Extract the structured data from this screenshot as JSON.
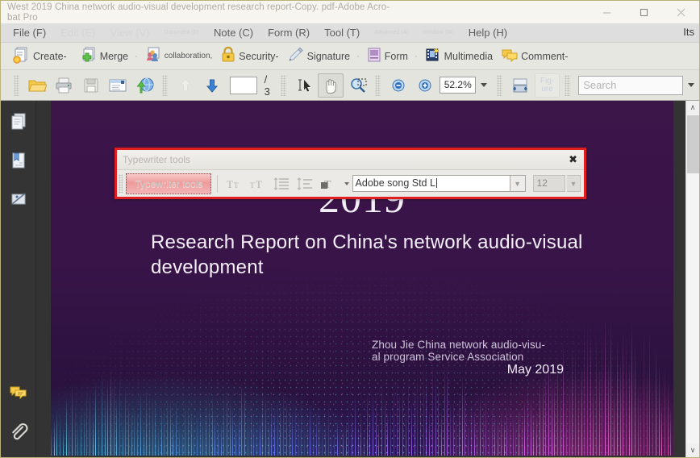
{
  "window": {
    "title": "West 2019 China network audio-visual development research report-Copy. pdf-Adobe Acro-\nbat Pro",
    "minimize_label": "Minimize",
    "maximize_label": "Maximize",
    "close_label": "Close"
  },
  "menubar": {
    "items": [
      {
        "label": "File (F)",
        "state": "normal"
      },
      {
        "label": "Edit (E)",
        "state": "faded"
      },
      {
        "label": "View (V)",
        "state": "faded"
      },
      {
        "label": "Document (D)",
        "state": "faded-small"
      },
      {
        "label": "Note (C)",
        "state": "normal"
      },
      {
        "label": "Form (R)",
        "state": "normal"
      },
      {
        "label": "Tool (T)",
        "state": "normal"
      },
      {
        "label": "Advanced (A)",
        "state": "faded-small"
      },
      {
        "label": "Window (W)",
        "state": "faded-small"
      },
      {
        "label": "Help (H)",
        "state": "normal"
      }
    ],
    "corner_text": "Its"
  },
  "toolbar_main": {
    "buttons": [
      {
        "label": "Create-",
        "icon": "create-document-icon",
        "sep": ""
      },
      {
        "label": "Merge",
        "icon": "merge-documents-icon",
        "sep": "·"
      },
      {
        "label": "collaboration,",
        "icon": "collaboration-icon",
        "sep": ""
      },
      {
        "label": "Security-",
        "icon": "lock-security-icon",
        "sep": ""
      },
      {
        "label": "Signature",
        "icon": "pen-signature-icon",
        "sep": "·"
      },
      {
        "label": "Form",
        "icon": "form-icon",
        "sep": "·"
      },
      {
        "label": "Multimedia",
        "icon": "multimedia-film-icon",
        "sep": ""
      },
      {
        "label": "Comment-",
        "icon": "comment-bubble-icon",
        "sep": ""
      }
    ]
  },
  "toolbar_nav": {
    "open_icon": "open-folder-icon",
    "print_icon": "print-icon",
    "save_icon": "save-floppy-icon",
    "email_icon": "email-icon",
    "upload_icon": "upload-web-icon",
    "prev_page_icon": "previous-page-icon",
    "next_page_icon": "next-page-icon",
    "page_number": "",
    "page_total": "/ 3",
    "select_tool_icon": "select-text-icon",
    "hand_tool_icon": "hand-tool-icon",
    "zoom_tool_icon": "marquee-zoom-icon",
    "zoom_out_icon": "zoom-out-icon",
    "zoom_in_icon": "zoom-in-icon",
    "zoom_value": "52.2%",
    "fit_width_icon": "fit-width-icon",
    "figure_label_line1": "Fig-",
    "figure_label_line2": "ure",
    "search_placeholder": "Search"
  },
  "sidebar": {
    "items": [
      {
        "name": "page-thumbnails",
        "icon": "pages-icon"
      },
      {
        "name": "bookmarks",
        "icon": "bookmark-icon"
      },
      {
        "name": "signatures",
        "icon": "signature-pen-icon"
      },
      {
        "name": "comments",
        "icon": "comments-icon"
      },
      {
        "name": "attachments",
        "icon": "paperclip-icon"
      }
    ]
  },
  "typewriter_panel": {
    "title": "Typewriter tools",
    "close_label": "✖",
    "main_button_label": "Typewriter tools",
    "buttons": [
      {
        "name": "decrease-text-size",
        "glyph": "Tᴛ"
      },
      {
        "name": "increase-text-size",
        "glyph": "ᴛT"
      },
      {
        "name": "line-spacing",
        "glyph": "≡"
      },
      {
        "name": "character-spacing",
        "glyph": "≡"
      },
      {
        "name": "text-color",
        "glyph": "T"
      }
    ],
    "font_name": "Adobe song Std L",
    "font_size": "12"
  },
  "document": {
    "year": "2019",
    "title": "Research Report on China's network audio-visual development",
    "author": "Zhou Jie China network audio-visu-\nal program Service Association",
    "date": "May 2019",
    "bg_color": "#3a1447"
  },
  "scrollbar": {
    "up_arrow": "∧",
    "down_arrow": "∨"
  }
}
